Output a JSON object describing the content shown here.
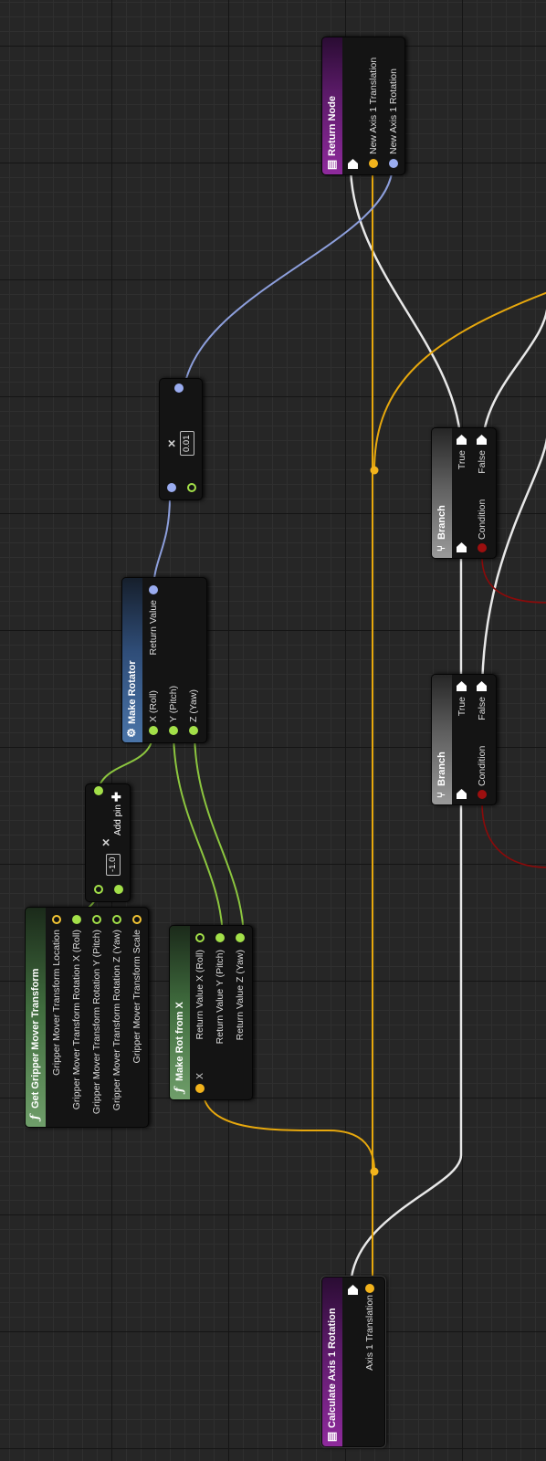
{
  "nodes": {
    "calc": {
      "title": "Calculate Axis 1 Rotation",
      "pin_translation": "Axis 1 Translation"
    },
    "ret": {
      "title": "Return Node",
      "pin_translation": "New Axis 1 Translation",
      "pin_rotation": "New Axis 1 Rotation"
    },
    "get_gripper": {
      "title": "Get Gripper Mover Transform",
      "pins": [
        "Gripper Mover Transform Location",
        "Gripper Mover Transform Rotation X (Roll)",
        "Gripper Mover Transform Rotation Y (Pitch)",
        "Gripper Mover Transform Rotation Z (Yaw)",
        "Gripper Mover Transform Scale"
      ]
    },
    "multiply_neg": {
      "symbol": "×",
      "value": "-1.0",
      "add_pin": "Add pin"
    },
    "make_rot_from_x": {
      "title": "Make Rot from X",
      "input": "X",
      "pins": [
        "Return Value X (Roll)",
        "Return Value Y (Pitch)",
        "Return Value Z (Yaw)"
      ]
    },
    "make_rotator": {
      "title": "Make Rotator",
      "inputs": [
        "X (Roll)",
        "Y (Pitch)",
        "Z (Yaw)"
      ],
      "output": "Return Value"
    },
    "multiply_small": {
      "symbol": "×",
      "value": "0.01"
    },
    "branch1": {
      "title": "Branch",
      "condition": "Condition",
      "true_label": "True",
      "false_label": "False"
    },
    "branch2": {
      "title": "Branch",
      "condition": "Condition",
      "true_label": "True",
      "false_label": "False"
    }
  },
  "icons": {
    "function": "function-icon",
    "entry": "entry-node-icon",
    "return": "return-node-icon",
    "branch": "branch-icon",
    "struct": "struct-icon"
  },
  "colors": {
    "exec": "#ffffff",
    "float": "#a3e049",
    "translation": "#f2b31c",
    "rotator": "#9aacf0",
    "bool": "#9c0f0f",
    "vector": "#f2c534"
  }
}
